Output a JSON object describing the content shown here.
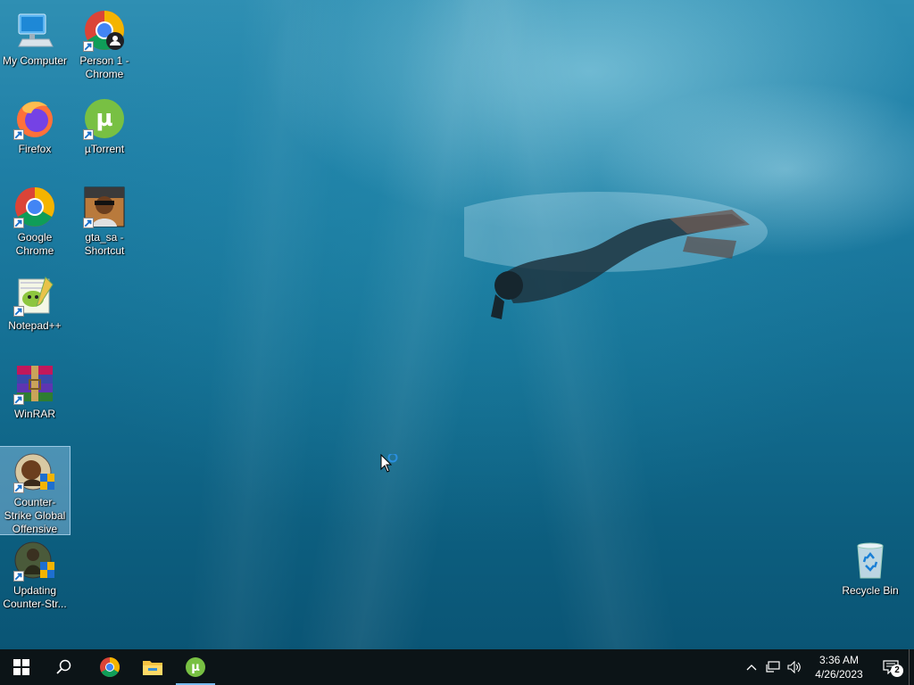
{
  "desktop": {
    "icons": [
      {
        "label": "My Computer"
      },
      {
        "label": "Person 1 - Chrome"
      },
      {
        "label": "Firefox"
      },
      {
        "label": "µTorrent"
      },
      {
        "label": "Google Chrome"
      },
      {
        "label": "gta_sa - Shortcut"
      },
      {
        "label": "Notepad++"
      },
      {
        "label": "WinRAR"
      },
      {
        "label": "Counter-Strike Global Offensive"
      },
      {
        "label": "Updating Counter-Str..."
      },
      {
        "label": "Recycle Bin"
      }
    ]
  },
  "taskbar": {
    "start_icon": "windows-start-icon",
    "search_icon": "search-icon",
    "pinned": [
      "chrome-icon",
      "file-explorer-icon",
      "utorrent-icon"
    ],
    "active_app": "utorrent-icon"
  },
  "tray": {
    "time": "3:36 AM",
    "date": "4/26/2023",
    "notification_count": "2"
  },
  "colors": {
    "taskbar_bg": "#0c1417",
    "selection": "#96c8eb",
    "accent": "#76b9ed"
  }
}
